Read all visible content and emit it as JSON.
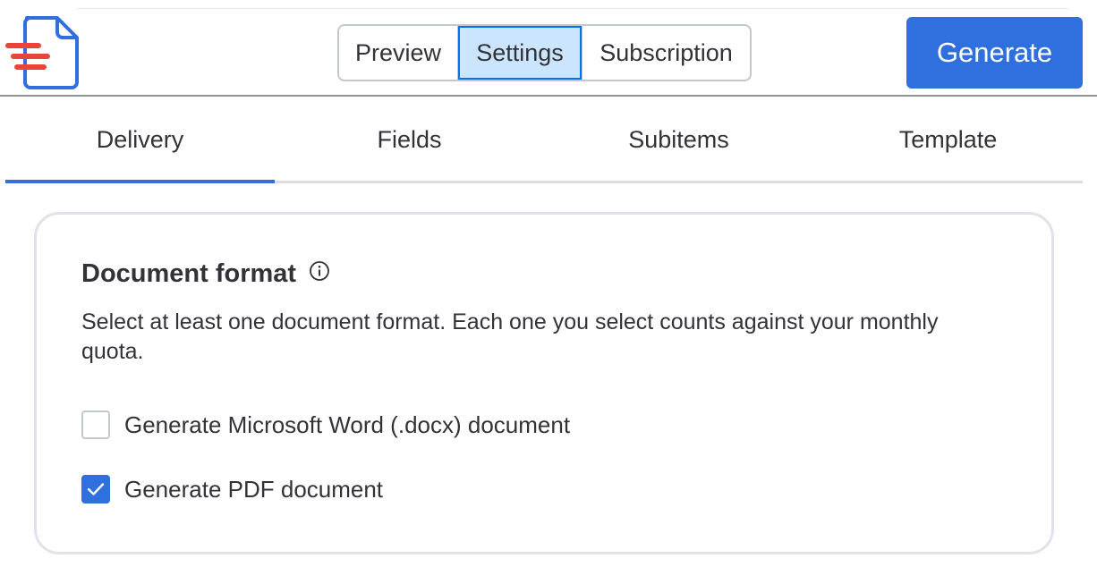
{
  "header": {
    "segments": [
      "Preview",
      "Settings",
      "Subscription"
    ],
    "selected_segment": "Settings",
    "generate_label": "Generate"
  },
  "tabs": {
    "items": [
      "Delivery",
      "Fields",
      "Subitems",
      "Template"
    ],
    "active": "Delivery"
  },
  "document_format": {
    "title": "Document format",
    "description": "Select at least one document format. Each one you select counts against your monthly quota.",
    "options": [
      {
        "label": "Generate Microsoft Word (.docx) document",
        "checked": false
      },
      {
        "label": "Generate PDF document",
        "checked": true
      }
    ]
  },
  "colors": {
    "accent": "#2f6fde",
    "selected_segment_bg": "#cce5ff",
    "logo_red": "#e8453c",
    "text": "#323338"
  },
  "icons": {
    "logo": "document-logo-icon",
    "info": "info-icon",
    "check": "check-icon"
  }
}
